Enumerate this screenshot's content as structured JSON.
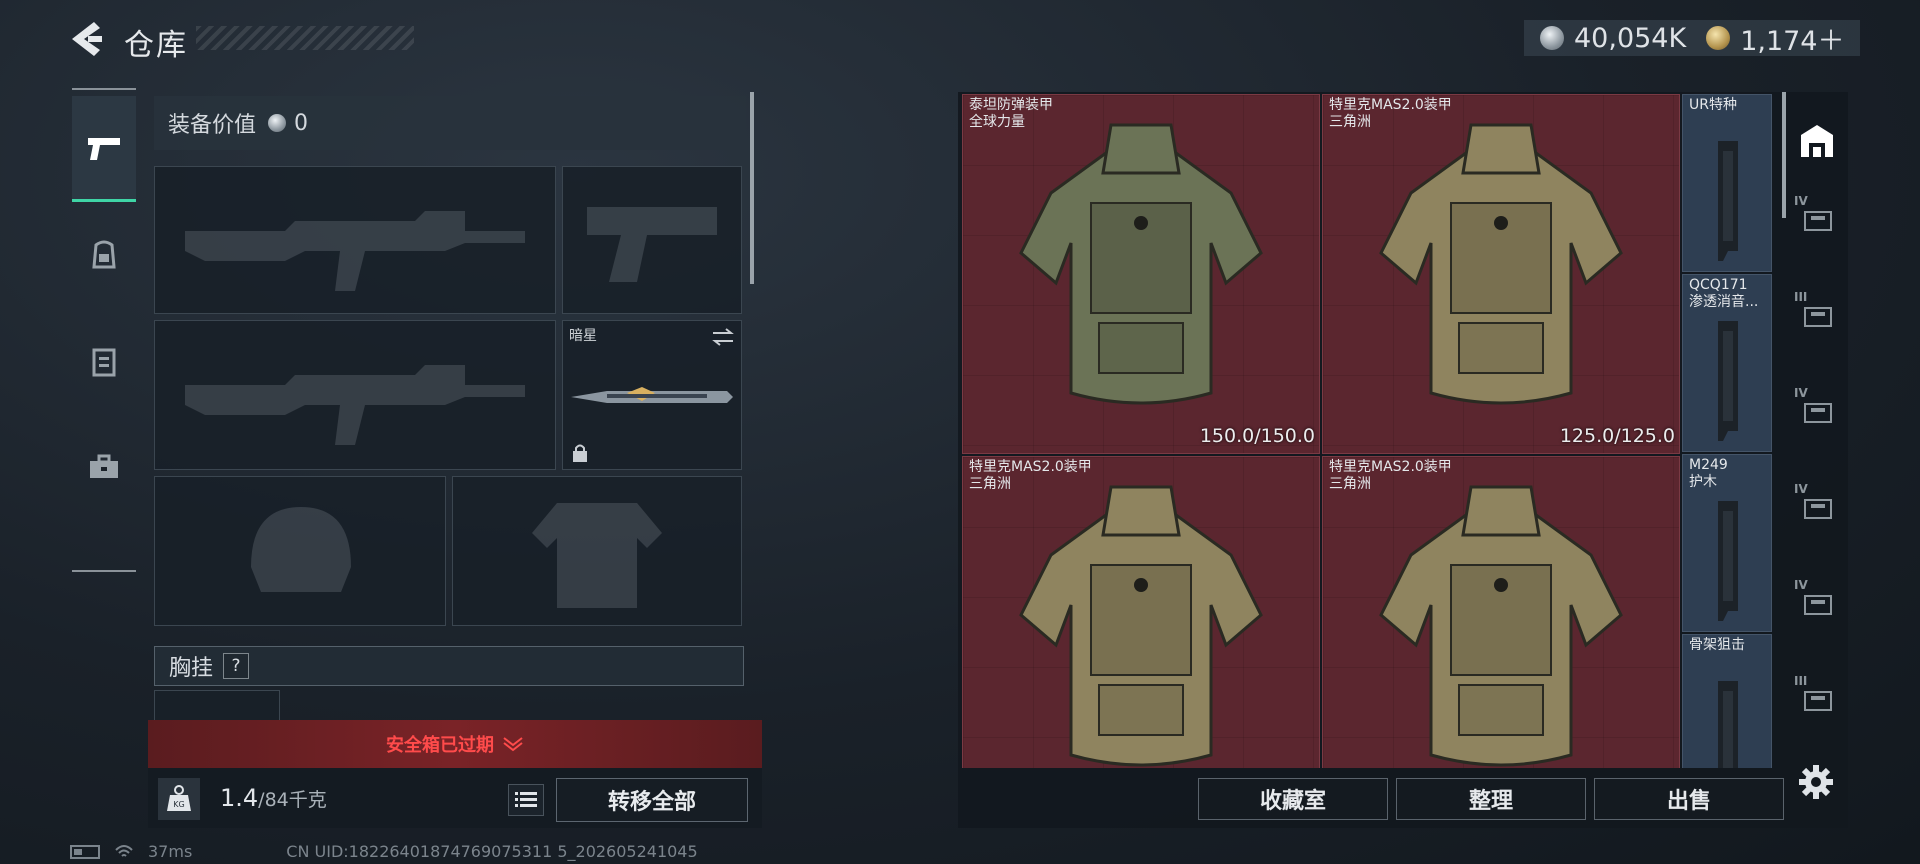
{
  "header": {
    "title": "仓库",
    "currency_silver": "40,054K",
    "currency_gold": "1,174＋"
  },
  "equipment": {
    "value_label": "装备价值",
    "value": "0",
    "melee_name": "暗星",
    "chest_label": "胸挂",
    "chest_help": "?"
  },
  "safebox_warning": "安全箱已过期",
  "weight": {
    "current": "1.4",
    "max": "/84千克"
  },
  "transfer_all_label": "转移全部",
  "status": {
    "ping": "37ms",
    "uid": "CN UID:18226401874769075311 5_202605241045"
  },
  "inventory": {
    "large_items": [
      {
        "name": [
          "泰坦防弹装甲",
          "全球力量"
        ],
        "durability": "150.0/150.0",
        "color": "#6b7356"
      },
      {
        "name": [
          "特里克MAS2.0装甲",
          "三角洲"
        ],
        "durability": "125.0/125.0",
        "color": "#8f845f"
      },
      {
        "name": [
          "特里克MAS2.0装甲",
          "三角洲"
        ],
        "durability": "",
        "color": "#8f845f"
      },
      {
        "name": [
          "特里克MAS2.0装甲",
          "三角洲"
        ],
        "durability": "",
        "color": "#8f845f"
      }
    ],
    "small_items": [
      {
        "name": [
          "UR特种"
        ]
      },
      {
        "name": [
          "QCQ171",
          "渗透消音..."
        ]
      },
      {
        "name": [
          "M249",
          "护木"
        ]
      },
      {
        "name": [
          "骨架狙击"
        ]
      }
    ],
    "tab_levels": [
      "IV",
      "III",
      "IV",
      "IV",
      "IV",
      "III"
    ]
  },
  "actions": {
    "collection": "收藏室",
    "organize": "整理",
    "sell": "出售"
  },
  "colors": {
    "accent": "#3fd5a6",
    "warning": "#ff4b4b",
    "item_red": "#5b262f",
    "item_blue": "#2e3e52"
  }
}
